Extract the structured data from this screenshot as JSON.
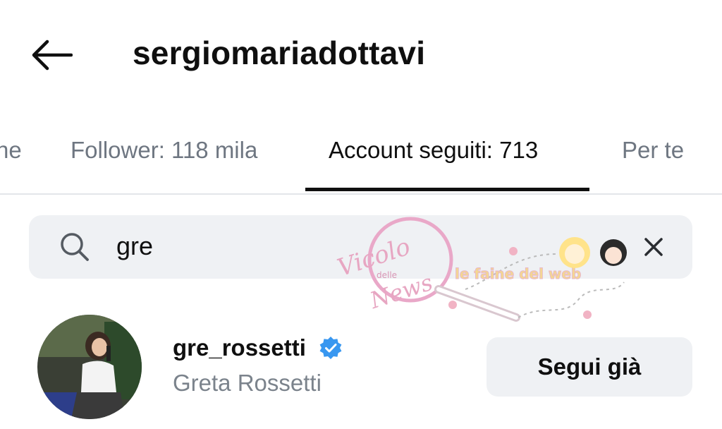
{
  "header": {
    "back_icon": "arrow-left-icon",
    "title": "sergiomariadottavi"
  },
  "tabs": [
    {
      "label": "ne",
      "active": false
    },
    {
      "label": "Follower: 118 mila",
      "active": false
    },
    {
      "label": "Account seguiti: 713",
      "active": true
    },
    {
      "label": "Per te",
      "active": false
    }
  ],
  "search": {
    "icon": "search-icon",
    "value": "gre",
    "clear_icon": "close-icon"
  },
  "watermark": {
    "brand": "Vicolo delle News",
    "tagline": "le faine del web"
  },
  "results": [
    {
      "username": "gre_rossetti",
      "verified": true,
      "full_name": "Greta Rossetti",
      "button_label": "Segui già"
    }
  ],
  "colors": {
    "accent_verified": "#3897f0",
    "muted_text": "#6e7681",
    "search_bg": "#eff1f4"
  }
}
